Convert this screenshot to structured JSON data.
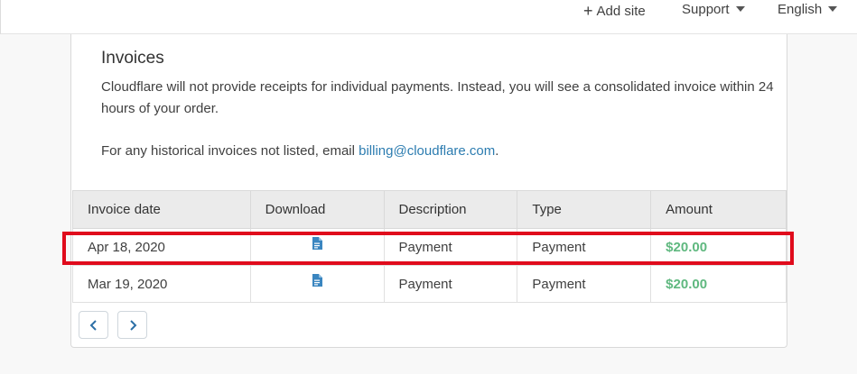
{
  "topbar": {
    "add_site": "Add site",
    "support": "Support",
    "language": "English"
  },
  "icons": {
    "plus": "plus-icon",
    "caret": "caret-down-icon",
    "document": "document-icon",
    "prev": "chevron-left-icon",
    "next": "chevron-right-icon"
  },
  "invoices": {
    "title": "Invoices",
    "description": "Cloudflare will not provide receipts for individual payments. Instead, you will see a consolidated invoice within 24 hours of your order.",
    "historical_prefix": "For any historical invoices not listed, email ",
    "email": "billing@cloudflare.com",
    "historical_suffix": ".",
    "columns": [
      "Invoice date",
      "Download",
      "Description",
      "Type",
      "Amount"
    ],
    "rows": [
      {
        "date": "Apr 18, 2020",
        "description": "Payment",
        "type": "Payment",
        "amount": "$20.00"
      },
      {
        "date": "Mar 19, 2020",
        "description": "Payment",
        "type": "Payment",
        "amount": "$20.00"
      }
    ]
  },
  "colors": {
    "link": "#2c7cb0",
    "amount": "#5fb87f",
    "highlight": "#e00b1c",
    "header_bg": "#ebebeb"
  }
}
